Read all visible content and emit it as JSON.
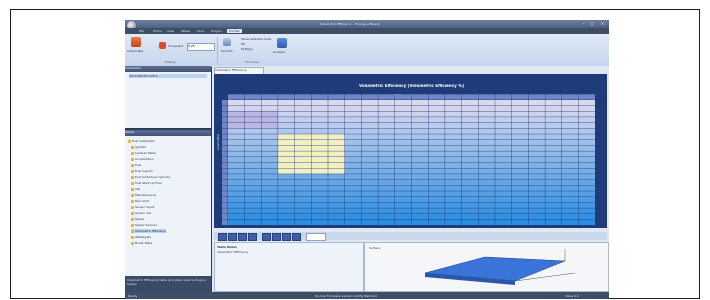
{
  "window": {
    "title": "Volumetric Efficiency - (Tuning software)",
    "controls": [
      "–",
      "□",
      "×"
    ]
  },
  "menu": {
    "tabs": [
      "File",
      "Home",
      "View",
      "Tables",
      "Tools",
      "Plugins",
      "Format"
    ],
    "active_index": 6
  },
  "ribbon": {
    "buttons": [
      "Interpolate",
      "Increment",
      "Smooth",
      "Show Selected Cells",
      "Fill",
      "Multiply",
      "Analyze"
    ],
    "increment_value": "0.25",
    "groups": [
      "Editing",
      "Formulas"
    ]
  },
  "left": {
    "top_panel_title": "Calibration",
    "top_panel_row": "AM-1000-ECU-VE-A",
    "tree_panel_title": "Tables",
    "tree_items": [
      "Fuel Calibration",
      "Ignition",
      "Lambda Table",
      "Acceleration",
      "Fuel",
      "Fuel Injector",
      "Fuel Individual Cylinder",
      "Fuel Start-Up Fuel",
      "Idle",
      "Miscellaneous",
      "Rev Limit",
      "Sensor Input",
      "Sensor Cal",
      "Speed",
      "Speed Sensors",
      "Volumetric Efficiency",
      "Wastegate",
      "Boost Table"
    ],
    "selected_index": 15,
    "description": "Volumetric Efficiency table at a given Load & Engine Speed"
  },
  "main": {
    "doc_tab": "Volumetric Efficiency",
    "chart_title": "Volumetric Efficiency [Volumetric Efficiency %]",
    "x_axis_label": "RPM [rev/min]",
    "y_axis_label": "Load [kPa]",
    "properties_title": "Table Notes",
    "properties_text": "Volumetric Efficiency",
    "plot_label": "Surface"
  },
  "status": {
    "left": "Ready",
    "center": "On-line  Firmware version  Config Matched",
    "right": "Value 0.0"
  },
  "colors": {
    "grid_high": "#dcd9ee",
    "grid_low": "#2b8de0",
    "selection": "#f2f0c2",
    "frame_bg": "#2b3b53"
  }
}
